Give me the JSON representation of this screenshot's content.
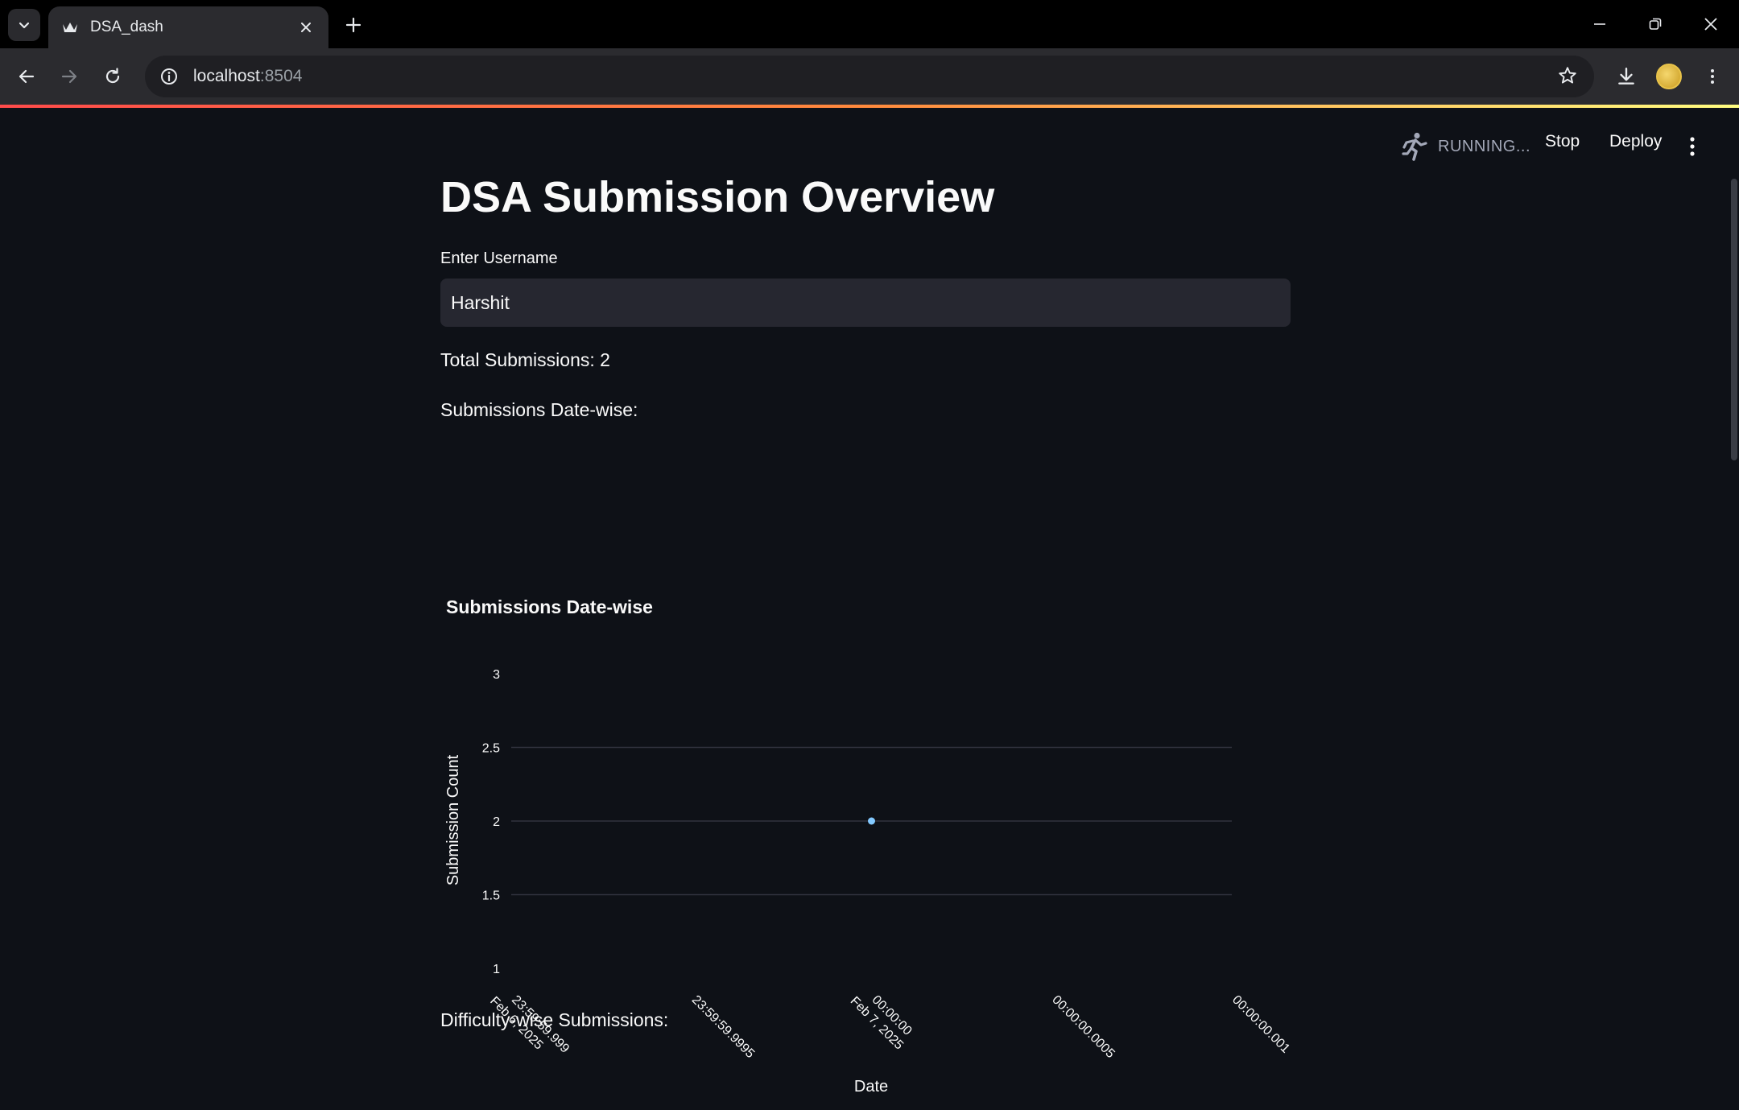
{
  "browser": {
    "tab_title": "DSA_dash",
    "url_host": "localhost",
    "url_port": ":8504"
  },
  "app_header": {
    "status": "RUNNING...",
    "stop_label": "Stop",
    "deploy_label": "Deploy"
  },
  "main": {
    "title": "DSA Submission Overview",
    "username_label": "Enter Username",
    "username_value": "Harshit",
    "total_submissions": "Total Submissions: 2",
    "datewise_heading": "Submissions Date-wise:",
    "difficulty_heading": "Difficulty-wise Submissions:"
  },
  "chart_data": {
    "type": "scatter",
    "title": "Submissions Date-wise",
    "xlabel": "Date",
    "ylabel": "Submission Count",
    "ylim": [
      1,
      3
    ],
    "yticks": [
      "1",
      "1.5",
      "2",
      "2.5",
      "3"
    ],
    "xticks": [
      [
        "23:59:59.999",
        "Feb 6, 2025"
      ],
      [
        "23:59:59.9995"
      ],
      [
        "00:00:00",
        "Feb 7, 2025"
      ],
      [
        "00:00:00.0005"
      ],
      [
        "00:00:00.001"
      ]
    ],
    "points": [
      {
        "x": "Feb 7, 2025 00:00:00",
        "y": 2
      }
    ],
    "grid": true,
    "color": "#83c9ff"
  }
}
